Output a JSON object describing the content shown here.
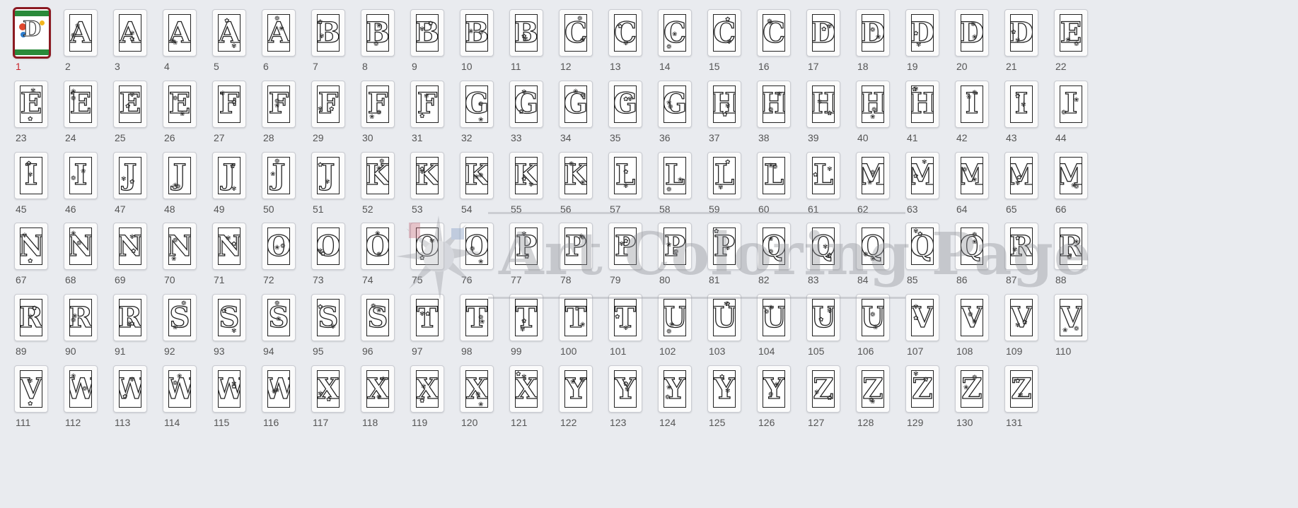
{
  "pages": {
    "selected_index": 0,
    "items": [
      {
        "num": "1",
        "letter": "",
        "cover": true
      },
      {
        "num": "2",
        "letter": "A"
      },
      {
        "num": "3",
        "letter": "A"
      },
      {
        "num": "4",
        "letter": "A"
      },
      {
        "num": "5",
        "letter": "A"
      },
      {
        "num": "6",
        "letter": "A"
      },
      {
        "num": "7",
        "letter": "B"
      },
      {
        "num": "8",
        "letter": "B"
      },
      {
        "num": "9",
        "letter": "B"
      },
      {
        "num": "10",
        "letter": "B"
      },
      {
        "num": "11",
        "letter": "B"
      },
      {
        "num": "12",
        "letter": "C"
      },
      {
        "num": "13",
        "letter": "C"
      },
      {
        "num": "14",
        "letter": "C"
      },
      {
        "num": "15",
        "letter": "C"
      },
      {
        "num": "16",
        "letter": "C"
      },
      {
        "num": "17",
        "letter": "D"
      },
      {
        "num": "18",
        "letter": "D"
      },
      {
        "num": "19",
        "letter": "D"
      },
      {
        "num": "20",
        "letter": "D"
      },
      {
        "num": "21",
        "letter": "D"
      },
      {
        "num": "22",
        "letter": "E"
      },
      {
        "num": "23",
        "letter": "E"
      },
      {
        "num": "24",
        "letter": "E"
      },
      {
        "num": "25",
        "letter": "E"
      },
      {
        "num": "26",
        "letter": "E"
      },
      {
        "num": "27",
        "letter": "F"
      },
      {
        "num": "28",
        "letter": "F"
      },
      {
        "num": "29",
        "letter": "F"
      },
      {
        "num": "30",
        "letter": "F"
      },
      {
        "num": "31",
        "letter": "F"
      },
      {
        "num": "32",
        "letter": "G"
      },
      {
        "num": "33",
        "letter": "G"
      },
      {
        "num": "34",
        "letter": "G"
      },
      {
        "num": "35",
        "letter": "G"
      },
      {
        "num": "36",
        "letter": "G"
      },
      {
        "num": "37",
        "letter": "H"
      },
      {
        "num": "38",
        "letter": "H"
      },
      {
        "num": "39",
        "letter": "H"
      },
      {
        "num": "40",
        "letter": "H"
      },
      {
        "num": "41",
        "letter": "H"
      },
      {
        "num": "42",
        "letter": "I"
      },
      {
        "num": "43",
        "letter": "I"
      },
      {
        "num": "44",
        "letter": "I"
      },
      {
        "num": "45",
        "letter": "I"
      },
      {
        "num": "46",
        "letter": "I"
      },
      {
        "num": "47",
        "letter": "J"
      },
      {
        "num": "48",
        "letter": "J"
      },
      {
        "num": "49",
        "letter": "J"
      },
      {
        "num": "50",
        "letter": "J"
      },
      {
        "num": "51",
        "letter": "J"
      },
      {
        "num": "52",
        "letter": "K"
      },
      {
        "num": "53",
        "letter": "K"
      },
      {
        "num": "54",
        "letter": "K"
      },
      {
        "num": "55",
        "letter": "K"
      },
      {
        "num": "56",
        "letter": "K"
      },
      {
        "num": "57",
        "letter": "L"
      },
      {
        "num": "58",
        "letter": "L"
      },
      {
        "num": "59",
        "letter": "L"
      },
      {
        "num": "60",
        "letter": "L"
      },
      {
        "num": "61",
        "letter": "L"
      },
      {
        "num": "62",
        "letter": "M"
      },
      {
        "num": "63",
        "letter": "M"
      },
      {
        "num": "64",
        "letter": "M"
      },
      {
        "num": "65",
        "letter": "M"
      },
      {
        "num": "66",
        "letter": "M"
      },
      {
        "num": "67",
        "letter": "N"
      },
      {
        "num": "68",
        "letter": "N"
      },
      {
        "num": "69",
        "letter": "N"
      },
      {
        "num": "70",
        "letter": "N"
      },
      {
        "num": "71",
        "letter": "N"
      },
      {
        "num": "72",
        "letter": "O"
      },
      {
        "num": "73",
        "letter": "O"
      },
      {
        "num": "74",
        "letter": "O"
      },
      {
        "num": "75",
        "letter": "O"
      },
      {
        "num": "76",
        "letter": "O"
      },
      {
        "num": "77",
        "letter": "P"
      },
      {
        "num": "78",
        "letter": "P"
      },
      {
        "num": "79",
        "letter": "P"
      },
      {
        "num": "80",
        "letter": "P"
      },
      {
        "num": "81",
        "letter": "P"
      },
      {
        "num": "82",
        "letter": "Q"
      },
      {
        "num": "83",
        "letter": "Q"
      },
      {
        "num": "84",
        "letter": "Q"
      },
      {
        "num": "85",
        "letter": "Q"
      },
      {
        "num": "86",
        "letter": "Q"
      },
      {
        "num": "87",
        "letter": "R"
      },
      {
        "num": "88",
        "letter": "R"
      },
      {
        "num": "89",
        "letter": "R"
      },
      {
        "num": "90",
        "letter": "R"
      },
      {
        "num": "91",
        "letter": "R"
      },
      {
        "num": "92",
        "letter": "S"
      },
      {
        "num": "93",
        "letter": "S"
      },
      {
        "num": "94",
        "letter": "S"
      },
      {
        "num": "95",
        "letter": "S"
      },
      {
        "num": "96",
        "letter": "S"
      },
      {
        "num": "97",
        "letter": "T"
      },
      {
        "num": "98",
        "letter": "T"
      },
      {
        "num": "99",
        "letter": "T"
      },
      {
        "num": "100",
        "letter": "T"
      },
      {
        "num": "101",
        "letter": "T"
      },
      {
        "num": "102",
        "letter": "U"
      },
      {
        "num": "103",
        "letter": "U"
      },
      {
        "num": "104",
        "letter": "U"
      },
      {
        "num": "105",
        "letter": "U"
      },
      {
        "num": "106",
        "letter": "U"
      },
      {
        "num": "107",
        "letter": "V"
      },
      {
        "num": "108",
        "letter": "V"
      },
      {
        "num": "109",
        "letter": "V"
      },
      {
        "num": "110",
        "letter": "V"
      },
      {
        "num": "111",
        "letter": "V"
      },
      {
        "num": "112",
        "letter": "W"
      },
      {
        "num": "113",
        "letter": "W"
      },
      {
        "num": "114",
        "letter": "W"
      },
      {
        "num": "115",
        "letter": "W"
      },
      {
        "num": "116",
        "letter": "W"
      },
      {
        "num": "117",
        "letter": "X"
      },
      {
        "num": "118",
        "letter": "X"
      },
      {
        "num": "119",
        "letter": "X"
      },
      {
        "num": "120",
        "letter": "X"
      },
      {
        "num": "121",
        "letter": "X"
      },
      {
        "num": "122",
        "letter": "Y"
      },
      {
        "num": "123",
        "letter": "Y"
      },
      {
        "num": "124",
        "letter": "Y"
      },
      {
        "num": "125",
        "letter": "Y"
      },
      {
        "num": "126",
        "letter": "Y"
      },
      {
        "num": "127",
        "letter": "Z"
      },
      {
        "num": "128",
        "letter": "Z"
      },
      {
        "num": "129",
        "letter": "Z"
      },
      {
        "num": "130",
        "letter": "Z"
      },
      {
        "num": "131",
        "letter": "Z"
      }
    ]
  },
  "watermark": {
    "text": "Art Coloring Page",
    "icon": "painter-palette-logo-icon"
  },
  "colors": {
    "background": "#e9ebef",
    "selected_border": "#8b1a22",
    "current_page_number": "#c8252b",
    "page_number": "#555555"
  }
}
